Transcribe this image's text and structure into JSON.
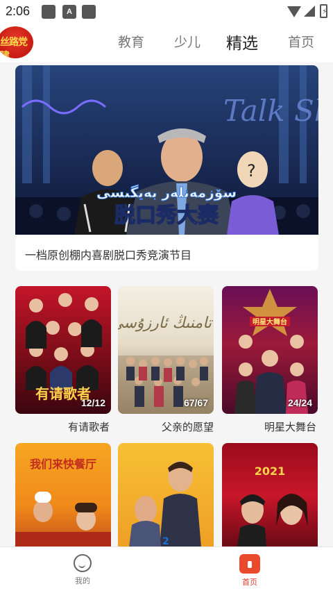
{
  "status": {
    "time": "2:06",
    "a_icon": "A"
  },
  "header": {
    "logo_text": "丝路党建",
    "tabs": [
      {
        "label": "教育"
      },
      {
        "label": "少儿"
      },
      {
        "label": "精选"
      },
      {
        "label": "首页"
      }
    ]
  },
  "banner": {
    "title": "脱口秀大赛",
    "uyghur_title": "سۆزمەنلەر بەيگىسى",
    "bg_text": "Talk Show",
    "caption": "一档原创棚内喜剧脱口秀竞演节目"
  },
  "posters": [
    {
      "title": "有请歌者",
      "count": "12/12",
      "overlay": "有请歌者"
    },
    {
      "title": "父亲的愿望",
      "count": "67/67",
      "overlay": "ئاتامنىڭ ئارزۇسى"
    },
    {
      "title": "明星大舞台",
      "count": "24/24",
      "overlay": "明星大舞台"
    },
    {
      "title": "",
      "count": "",
      "overlay": "我们来快餐厅"
    },
    {
      "title": "",
      "count": "",
      "overlay": ""
    },
    {
      "title": "",
      "count": "",
      "overlay": "2021"
    }
  ],
  "bottom_nav": [
    {
      "label": "我的",
      "icon": "user-icon"
    },
    {
      "label": "首页",
      "icon": "home-icon"
    }
  ]
}
